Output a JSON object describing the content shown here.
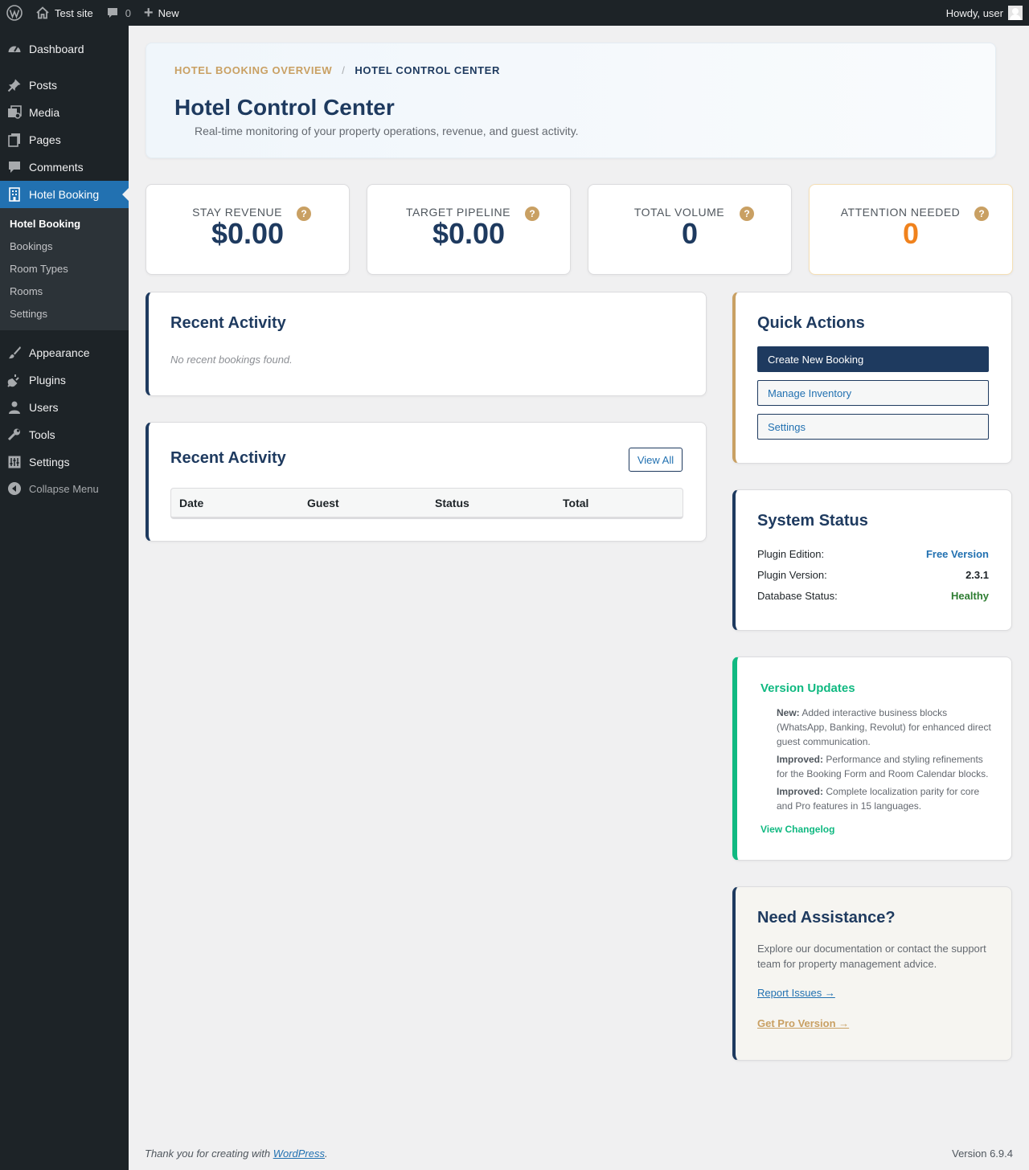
{
  "adminbar": {
    "site_name": "Test site",
    "comments_count": "0",
    "new_label": "New",
    "howdy": "Howdy, user"
  },
  "sidebar": {
    "items": [
      {
        "label": "Dashboard",
        "icon": "dashboard-icon"
      },
      {
        "label": "Posts",
        "icon": "pin-icon"
      },
      {
        "label": "Media",
        "icon": "media-icon"
      },
      {
        "label": "Pages",
        "icon": "pages-icon"
      },
      {
        "label": "Comments",
        "icon": "comment-icon"
      },
      {
        "label": "Hotel Booking",
        "icon": "building-icon"
      },
      {
        "label": "Appearance",
        "icon": "brush-icon"
      },
      {
        "label": "Plugins",
        "icon": "plugin-icon"
      },
      {
        "label": "Users",
        "icon": "user-icon"
      },
      {
        "label": "Tools",
        "icon": "wrench-icon"
      },
      {
        "label": "Settings",
        "icon": "settings-icon"
      }
    ],
    "submenu": [
      "Hotel Booking",
      "Bookings",
      "Room Types",
      "Rooms",
      "Settings"
    ],
    "collapse_label": "Collapse Menu"
  },
  "header": {
    "breadcrumb_parent": "HOTEL BOOKING OVERVIEW",
    "breadcrumb_sep": "/",
    "breadcrumb_current": "HOTEL CONTROL CENTER",
    "title": "Hotel Control Center",
    "subtitle": "Real-time monitoring of your property operations, revenue, and guest activity."
  },
  "stats": [
    {
      "label": "STAY REVENUE",
      "value": "$0.00"
    },
    {
      "label": "TARGET PIPELINE",
      "value": "$0.00"
    },
    {
      "label": "TOTAL VOLUME",
      "value": "0"
    },
    {
      "label": "ATTENTION NEEDED",
      "value": "0"
    }
  ],
  "help_glyph": "?",
  "recent_activity_1": {
    "title": "Recent Activity",
    "empty": "No recent bookings found."
  },
  "recent_activity_2": {
    "title": "Recent Activity",
    "view_all": "View All",
    "columns": [
      "Date",
      "Guest",
      "Status",
      "Total"
    ]
  },
  "quick_actions": {
    "title": "Quick Actions",
    "create": "Create New Booking",
    "inventory": "Manage Inventory",
    "settings": "Settings"
  },
  "system_status": {
    "title": "System Status",
    "rows": [
      {
        "label": "Plugin Edition:",
        "value": "Free Version",
        "color": "#2271b1"
      },
      {
        "label": "Plugin Version:",
        "value": "2.3.1",
        "color": "#1d2327"
      },
      {
        "label": "Database Status:",
        "value": "Healthy",
        "color": "#2e7d32"
      }
    ]
  },
  "version_updates": {
    "title": "Version Updates",
    "items": [
      {
        "tag": "New:",
        "text": "Added interactive business blocks (WhatsApp, Banking, Revolut) for enhanced direct guest communication."
      },
      {
        "tag": "Improved:",
        "text": "Performance and styling refinements for the Booking Form and Room Calendar blocks."
      },
      {
        "tag": "Improved:",
        "text": "Complete localization parity for core and Pro features in 15 languages."
      }
    ],
    "link": "View Changelog"
  },
  "assistance": {
    "title": "Need Assistance?",
    "text": "Explore our documentation or contact the support team for property management advice.",
    "report": "Report Issues →",
    "pro": "Get Pro Version →"
  },
  "footer": {
    "thanks_prefix": "Thank you for creating with",
    "wp_link": "WordPress",
    "thanks_suffix": ".",
    "version": "Version 6.9.4"
  },
  "colors": {
    "navy": "#1e3a5f",
    "gold": "#c9a063",
    "green": "#10b981",
    "orange": "#f0821d",
    "wp_blue": "#2271b1"
  }
}
